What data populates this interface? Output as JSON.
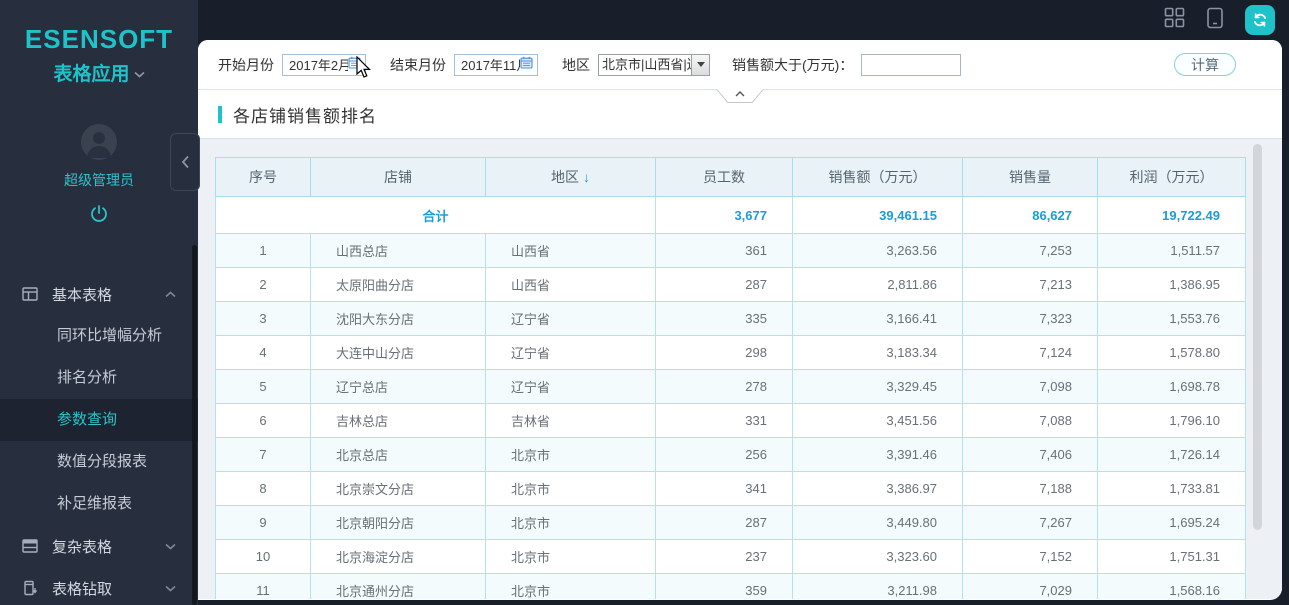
{
  "app": {
    "logo_line1": "ESENSOFT",
    "logo_line2": "表格应用",
    "user_name": "超级管理员"
  },
  "sidebar": {
    "menu": [
      {
        "label": "基本表格",
        "expanded": true,
        "items": [
          "同环比增幅分析",
          "排名分析",
          "参数查询",
          "数值分段报表",
          "补足维报表"
        ],
        "active_item": "参数查询"
      },
      {
        "label": "复杂表格",
        "expanded": false
      },
      {
        "label": "表格钻取",
        "expanded": false
      }
    ]
  },
  "filters": {
    "start_label": "开始月份",
    "start_value": "2017年2月",
    "end_label": "结束月份",
    "end_value": "2017年11月",
    "region_label": "地区",
    "region_value": "北京市|山西省|辽",
    "sales_label": "销售额大于(万元)：",
    "sales_value": "",
    "calc_button": "计算"
  },
  "report": {
    "title": "各店铺销售额排名",
    "columns": [
      "序号",
      "店铺",
      "地区",
      "员工数",
      "销售额（万元）",
      "销售量",
      "利润（万元）"
    ],
    "sort": {
      "column": "地区",
      "arrow": "↓"
    },
    "total": {
      "label": "合计",
      "employees": "3,677",
      "sales": "39,461.15",
      "quantity": "86,627",
      "profit": "19,722.49"
    },
    "rows": [
      {
        "no": "1",
        "store": "山西总店",
        "region": "山西省",
        "employees": "361",
        "sales": "3,263.56",
        "quantity": "7,253",
        "profit": "1,511.57"
      },
      {
        "no": "2",
        "store": "太原阳曲分店",
        "region": "山西省",
        "employees": "287",
        "sales": "2,811.86",
        "quantity": "7,213",
        "profit": "1,386.95"
      },
      {
        "no": "3",
        "store": "沈阳大东分店",
        "region": "辽宁省",
        "employees": "335",
        "sales": "3,166.41",
        "quantity": "7,323",
        "profit": "1,553.76"
      },
      {
        "no": "4",
        "store": "大连中山分店",
        "region": "辽宁省",
        "employees": "298",
        "sales": "3,183.34",
        "quantity": "7,124",
        "profit": "1,578.80"
      },
      {
        "no": "5",
        "store": "辽宁总店",
        "region": "辽宁省",
        "employees": "278",
        "sales": "3,329.45",
        "quantity": "7,098",
        "profit": "1,698.78"
      },
      {
        "no": "6",
        "store": "吉林总店",
        "region": "吉林省",
        "employees": "331",
        "sales": "3,451.56",
        "quantity": "7,088",
        "profit": "1,796.10"
      },
      {
        "no": "7",
        "store": "北京总店",
        "region": "北京市",
        "employees": "256",
        "sales": "3,391.46",
        "quantity": "7,406",
        "profit": "1,726.14"
      },
      {
        "no": "8",
        "store": "北京崇文分店",
        "region": "北京市",
        "employees": "341",
        "sales": "3,386.97",
        "quantity": "7,188",
        "profit": "1,733.81"
      },
      {
        "no": "9",
        "store": "北京朝阳分店",
        "region": "北京市",
        "employees": "287",
        "sales": "3,449.80",
        "quantity": "7,267",
        "profit": "1,695.24"
      },
      {
        "no": "10",
        "store": "北京海淀分店",
        "region": "北京市",
        "employees": "237",
        "sales": "3,323.60",
        "quantity": "7,152",
        "profit": "1,751.31"
      },
      {
        "no": "11",
        "store": "北京通州分店",
        "region": "北京市",
        "employees": "359",
        "sales": "3,211.98",
        "quantity": "7,029",
        "profit": "1,568.16"
      }
    ]
  },
  "colors": {
    "accent": "#1ec3c9",
    "total_value_blue": "#1b9dd9",
    "table_border": "#abdcec"
  }
}
